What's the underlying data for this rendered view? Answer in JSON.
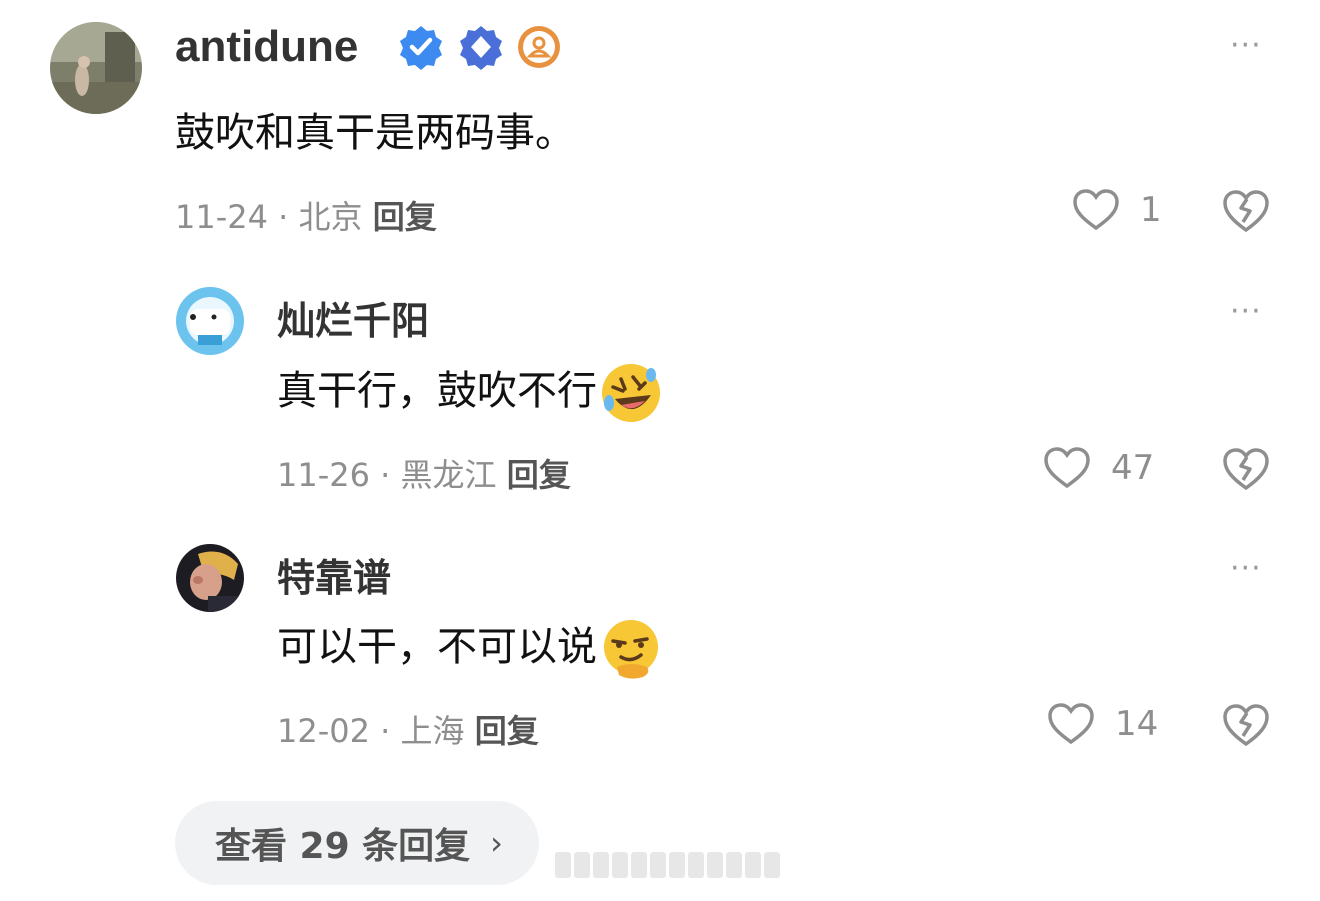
{
  "comments": [
    {
      "name": "antidune",
      "text": "鼓吹和真干是两码事。",
      "date": "11-24",
      "location": "北京",
      "reply_label": "回复",
      "likes": "1",
      "badges": [
        "verified-icon",
        "diamond-badge-icon",
        "person-badge-icon"
      ]
    },
    {
      "name": "灿烂千阳",
      "text": "真干行，鼓吹不行",
      "emoji": "rofl-emoji",
      "date": "11-26",
      "location": "黑龙江",
      "reply_label": "回复",
      "likes": "47"
    },
    {
      "name": "特靠谱",
      "text": "可以干，不可以说",
      "emoji": "smirk-emoji",
      "date": "12-02",
      "location": "上海",
      "reply_label": "回复",
      "likes": "14"
    }
  ],
  "separator": "·",
  "more_label": "···",
  "view_more": {
    "label": "查看 29 条回复",
    "chevron": "›"
  },
  "colors": {
    "verified": "#3d8bf0",
    "diamond": "#4a6fd8",
    "orange_badge": "#e8913f",
    "emoji": "#f8c736"
  }
}
